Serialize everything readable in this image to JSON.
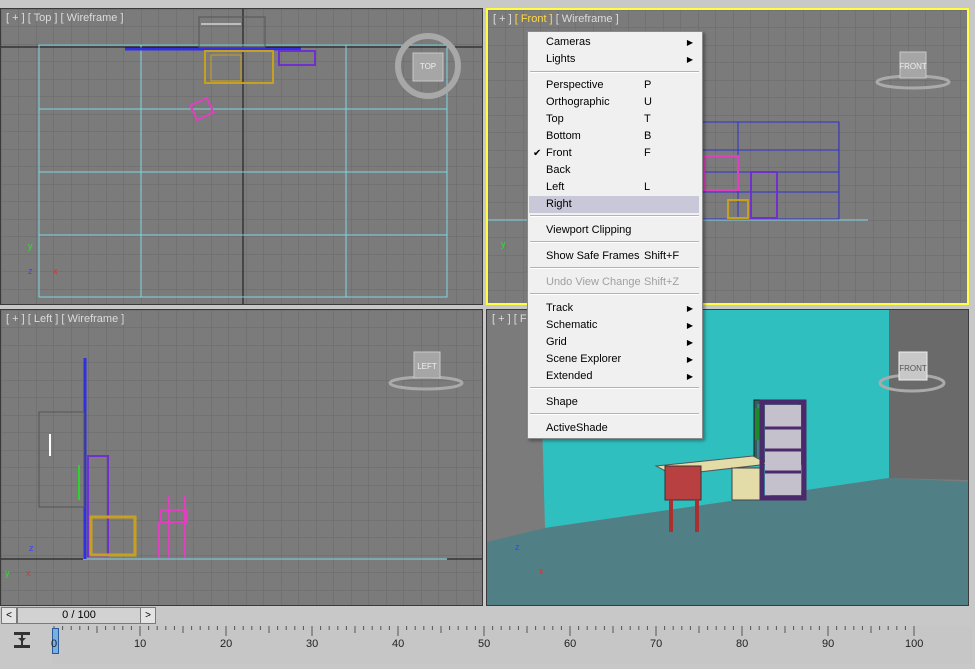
{
  "viewports": {
    "top": {
      "plus": "[ + ]",
      "name": "[ Top ]",
      "mode": "[ Wireframe ]",
      "cube": "TOP"
    },
    "front": {
      "plus": "[ + ]",
      "name": "[ Front ]",
      "mode": "[ Wireframe ]",
      "cube": "FRONT"
    },
    "left": {
      "plus": "[ + ]",
      "name": "[ Left ]",
      "mode": "[ Wireframe ]",
      "cube": "LEFT"
    },
    "persp": {
      "plus": "[ + ]",
      "name": "[ F",
      "cube": "FRONT"
    }
  },
  "axes": {
    "y": "y",
    "z": "z",
    "x": "x"
  },
  "menu": {
    "cameras": "Cameras",
    "lights": "Lights",
    "perspective": "Perspective",
    "perspective_sc": "P",
    "orthographic": "Orthographic",
    "orthographic_sc": "U",
    "top": "Top",
    "top_sc": "T",
    "bottom": "Bottom",
    "bottom_sc": "B",
    "front": "Front",
    "front_sc": "F",
    "back": "Back",
    "left": "Left",
    "left_sc": "L",
    "right": "Right",
    "viewport_clipping": "Viewport Clipping",
    "show_safe_frames": "Show Safe Frames",
    "show_safe_frames_sc": "Shift+F",
    "undo_view_change": "Undo View Change",
    "undo_view_change_sc": "Shift+Z",
    "track": "Track",
    "schematic": "Schematic",
    "grid": "Grid",
    "scene_explorer": "Scene Explorer",
    "extended": "Extended",
    "shape": "Shape",
    "activeshade": "ActiveShade"
  },
  "time_slider": {
    "prev": "<",
    "value": "0 / 100",
    "next": ">"
  },
  "ruler_labels": [
    "0",
    "10",
    "20",
    "30",
    "40",
    "50",
    "60",
    "70",
    "80",
    "90",
    "100"
  ],
  "colors": {
    "viewport_bg": "#7b7b7b",
    "grid_line": "#6a6a6a",
    "active_border": "#ffff40",
    "wall_cyan": "#2fbfbf",
    "floor": "#507f86"
  }
}
